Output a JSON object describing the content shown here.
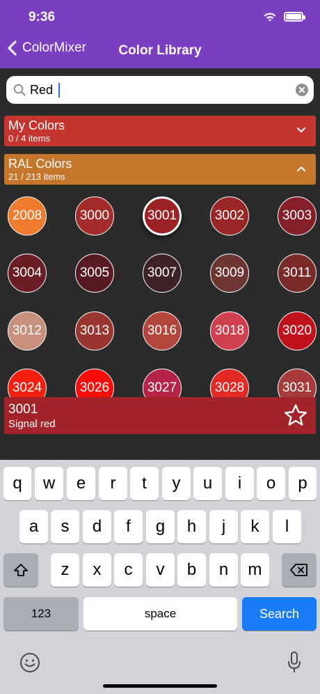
{
  "status": {
    "time": "9:36"
  },
  "nav": {
    "back_label": "ColorMixer",
    "title": "Color Library"
  },
  "search": {
    "value": "Red"
  },
  "sections": [
    {
      "title": "My Colors",
      "count": "0 / 4 items",
      "color": "#c3352e"
    },
    {
      "title": "RAL Colors",
      "count": "21 / 213 items",
      "color": "#c6762a"
    }
  ],
  "swatches": [
    {
      "code": "2008",
      "color": "#ef7b2e"
    },
    {
      "code": "3000",
      "color": "#a32c2a"
    },
    {
      "code": "3001",
      "color": "#9c2226"
    },
    {
      "code": "3002",
      "color": "#9b2628"
    },
    {
      "code": "3003",
      "color": "#85202a"
    },
    {
      "code": "3004",
      "color": "#6a1d24"
    },
    {
      "code": "3005",
      "color": "#5a1a22"
    },
    {
      "code": "3007",
      "color": "#3d2227"
    },
    {
      "code": "3009",
      "color": "#6d3632"
    },
    {
      "code": "3011",
      "color": "#7b2a2a"
    },
    {
      "code": "3012",
      "color": "#c6907a"
    },
    {
      "code": "3013",
      "color": "#9b3530"
    },
    {
      "code": "3016",
      "color": "#b2463b"
    },
    {
      "code": "3018",
      "color": "#d1404f"
    },
    {
      "code": "3020",
      "color": "#c2121d"
    },
    {
      "code": "3024",
      "color": "#f41f0f"
    },
    {
      "code": "3026",
      "color": "#fd0a0b"
    },
    {
      "code": "3027",
      "color": "#b62548"
    },
    {
      "code": "3028",
      "color": "#e32a24"
    },
    {
      "code": "3031",
      "color": "#a73b3b"
    }
  ],
  "selected": {
    "code": "3001",
    "name": "Signal red"
  },
  "keyboard": {
    "row1": [
      "q",
      "w",
      "e",
      "r",
      "t",
      "y",
      "u",
      "i",
      "o",
      "p"
    ],
    "row2": [
      "a",
      "s",
      "d",
      "f",
      "g",
      "h",
      "j",
      "k",
      "l"
    ],
    "row3": [
      "z",
      "x",
      "c",
      "v",
      "b",
      "n",
      "m"
    ],
    "numbers": "123",
    "space": "space",
    "search": "Search"
  }
}
